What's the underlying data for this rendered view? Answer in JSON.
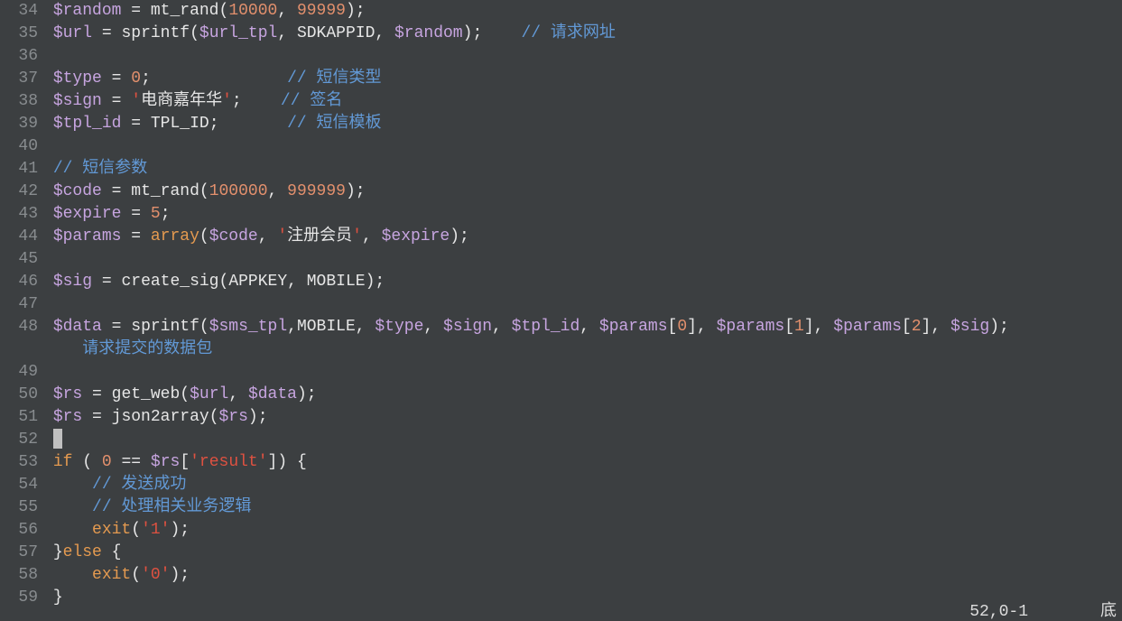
{
  "status": {
    "pos": "52,0-1",
    "mode_hint": "底"
  },
  "lines": [
    {
      "n": "34",
      "wrap": false,
      "tokens": [
        {
          "t": "var",
          "v": "$random"
        },
        {
          "t": "wht",
          "v": " "
        },
        {
          "t": "op",
          "v": "="
        },
        {
          "t": "wht",
          "v": " "
        },
        {
          "t": "func",
          "v": "mt_rand"
        },
        {
          "t": "op",
          "v": "("
        },
        {
          "t": "num",
          "v": "10000"
        },
        {
          "t": "op",
          "v": ","
        },
        {
          "t": "wht",
          "v": " "
        },
        {
          "t": "num",
          "v": "99999"
        },
        {
          "t": "op",
          "v": ")"
        },
        {
          "t": "op",
          "v": ";"
        }
      ]
    },
    {
      "n": "35",
      "wrap": false,
      "tokens": [
        {
          "t": "var",
          "v": "$url"
        },
        {
          "t": "wht",
          "v": " "
        },
        {
          "t": "op",
          "v": "="
        },
        {
          "t": "wht",
          "v": " "
        },
        {
          "t": "func",
          "v": "sprintf"
        },
        {
          "t": "op",
          "v": "("
        },
        {
          "t": "var",
          "v": "$url_tpl"
        },
        {
          "t": "op",
          "v": ","
        },
        {
          "t": "wht",
          "v": " "
        },
        {
          "t": "func",
          "v": "SDKAPPID"
        },
        {
          "t": "op",
          "v": ","
        },
        {
          "t": "wht",
          "v": " "
        },
        {
          "t": "var",
          "v": "$random"
        },
        {
          "t": "op",
          "v": ")"
        },
        {
          "t": "op",
          "v": ";"
        },
        {
          "t": "wht",
          "v": "    "
        },
        {
          "t": "cmt",
          "v": "// 请求网址"
        }
      ]
    },
    {
      "n": "36",
      "wrap": false,
      "tokens": []
    },
    {
      "n": "37",
      "wrap": false,
      "tokens": [
        {
          "t": "var",
          "v": "$type"
        },
        {
          "t": "wht",
          "v": " "
        },
        {
          "t": "op",
          "v": "="
        },
        {
          "t": "wht",
          "v": " "
        },
        {
          "t": "num",
          "v": "0"
        },
        {
          "t": "op",
          "v": ";"
        },
        {
          "t": "wht",
          "v": "              "
        },
        {
          "t": "cmt",
          "v": "// 短信类型"
        }
      ]
    },
    {
      "n": "38",
      "wrap": false,
      "tokens": [
        {
          "t": "var",
          "v": "$sign"
        },
        {
          "t": "wht",
          "v": " "
        },
        {
          "t": "op",
          "v": "="
        },
        {
          "t": "wht",
          "v": " "
        },
        {
          "t": "str",
          "v": "'"
        },
        {
          "t": "strc",
          "v": "电商嘉年华"
        },
        {
          "t": "str",
          "v": "'"
        },
        {
          "t": "op",
          "v": ";"
        },
        {
          "t": "wht",
          "v": "    "
        },
        {
          "t": "cmt",
          "v": "// 签名"
        }
      ]
    },
    {
      "n": "39",
      "wrap": false,
      "tokens": [
        {
          "t": "var",
          "v": "$tpl_id"
        },
        {
          "t": "wht",
          "v": " "
        },
        {
          "t": "op",
          "v": "="
        },
        {
          "t": "wht",
          "v": " "
        },
        {
          "t": "func",
          "v": "TPL_ID"
        },
        {
          "t": "op",
          "v": ";"
        },
        {
          "t": "wht",
          "v": "       "
        },
        {
          "t": "cmt",
          "v": "// 短信模板"
        }
      ]
    },
    {
      "n": "40",
      "wrap": false,
      "tokens": []
    },
    {
      "n": "41",
      "wrap": false,
      "tokens": [
        {
          "t": "cmt",
          "v": "// 短信参数"
        }
      ]
    },
    {
      "n": "42",
      "wrap": false,
      "tokens": [
        {
          "t": "var",
          "v": "$code"
        },
        {
          "t": "wht",
          "v": " "
        },
        {
          "t": "op",
          "v": "="
        },
        {
          "t": "wht",
          "v": " "
        },
        {
          "t": "func",
          "v": "mt_rand"
        },
        {
          "t": "op",
          "v": "("
        },
        {
          "t": "num",
          "v": "100000"
        },
        {
          "t": "op",
          "v": ","
        },
        {
          "t": "wht",
          "v": " "
        },
        {
          "t": "num",
          "v": "999999"
        },
        {
          "t": "op",
          "v": ")"
        },
        {
          "t": "op",
          "v": ";"
        }
      ]
    },
    {
      "n": "43",
      "wrap": false,
      "tokens": [
        {
          "t": "var",
          "v": "$expire"
        },
        {
          "t": "wht",
          "v": " "
        },
        {
          "t": "op",
          "v": "="
        },
        {
          "t": "wht",
          "v": " "
        },
        {
          "t": "num",
          "v": "5"
        },
        {
          "t": "op",
          "v": ";"
        }
      ]
    },
    {
      "n": "44",
      "wrap": false,
      "tokens": [
        {
          "t": "var",
          "v": "$params"
        },
        {
          "t": "wht",
          "v": " "
        },
        {
          "t": "op",
          "v": "="
        },
        {
          "t": "wht",
          "v": " "
        },
        {
          "t": "kw",
          "v": "array"
        },
        {
          "t": "op",
          "v": "("
        },
        {
          "t": "var",
          "v": "$code"
        },
        {
          "t": "op",
          "v": ","
        },
        {
          "t": "wht",
          "v": " "
        },
        {
          "t": "str",
          "v": "'"
        },
        {
          "t": "strc",
          "v": "注册会员"
        },
        {
          "t": "str",
          "v": "'"
        },
        {
          "t": "op",
          "v": ","
        },
        {
          "t": "wht",
          "v": " "
        },
        {
          "t": "var",
          "v": "$expire"
        },
        {
          "t": "op",
          "v": ")"
        },
        {
          "t": "op",
          "v": ";"
        }
      ]
    },
    {
      "n": "45",
      "wrap": false,
      "tokens": []
    },
    {
      "n": "46",
      "wrap": false,
      "tokens": [
        {
          "t": "var",
          "v": "$sig"
        },
        {
          "t": "wht",
          "v": " "
        },
        {
          "t": "op",
          "v": "="
        },
        {
          "t": "wht",
          "v": " "
        },
        {
          "t": "func",
          "v": "create_sig"
        },
        {
          "t": "op",
          "v": "("
        },
        {
          "t": "func",
          "v": "APPKEY"
        },
        {
          "t": "op",
          "v": ","
        },
        {
          "t": "wht",
          "v": " "
        },
        {
          "t": "func",
          "v": "MOBILE"
        },
        {
          "t": "op",
          "v": ")"
        },
        {
          "t": "op",
          "v": ";"
        }
      ]
    },
    {
      "n": "47",
      "wrap": false,
      "tokens": []
    },
    {
      "n": "48",
      "wrap": false,
      "tokens": [
        {
          "t": "var",
          "v": "$data"
        },
        {
          "t": "wht",
          "v": " "
        },
        {
          "t": "op",
          "v": "="
        },
        {
          "t": "wht",
          "v": " "
        },
        {
          "t": "func",
          "v": "sprintf"
        },
        {
          "t": "op",
          "v": "("
        },
        {
          "t": "var",
          "v": "$sms_tpl"
        },
        {
          "t": "op",
          "v": ","
        },
        {
          "t": "func",
          "v": "MOBILE"
        },
        {
          "t": "op",
          "v": ","
        },
        {
          "t": "wht",
          "v": " "
        },
        {
          "t": "var",
          "v": "$type"
        },
        {
          "t": "op",
          "v": ","
        },
        {
          "t": "wht",
          "v": " "
        },
        {
          "t": "var",
          "v": "$sign"
        },
        {
          "t": "op",
          "v": ","
        },
        {
          "t": "wht",
          "v": " "
        },
        {
          "t": "var",
          "v": "$tpl_id"
        },
        {
          "t": "op",
          "v": ","
        },
        {
          "t": "wht",
          "v": " "
        },
        {
          "t": "var",
          "v": "$params"
        },
        {
          "t": "op",
          "v": "["
        },
        {
          "t": "num",
          "v": "0"
        },
        {
          "t": "op",
          "v": "]"
        },
        {
          "t": "op",
          "v": ","
        },
        {
          "t": "wht",
          "v": " "
        },
        {
          "t": "var",
          "v": "$params"
        },
        {
          "t": "op",
          "v": "["
        },
        {
          "t": "num",
          "v": "1"
        },
        {
          "t": "op",
          "v": "]"
        },
        {
          "t": "op",
          "v": ","
        },
        {
          "t": "wht",
          "v": " "
        },
        {
          "t": "var",
          "v": "$params"
        },
        {
          "t": "op",
          "v": "["
        },
        {
          "t": "num",
          "v": "2"
        },
        {
          "t": "op",
          "v": "]"
        },
        {
          "t": "op",
          "v": ","
        },
        {
          "t": "wht",
          "v": " "
        },
        {
          "t": "var",
          "v": "$sig"
        },
        {
          "t": "op",
          "v": ")"
        },
        {
          "t": "op",
          "v": ";"
        }
      ]
    },
    {
      "n": "",
      "wrap": true,
      "tokens": [
        {
          "t": "cmt",
          "v": "请求提交的数据包"
        }
      ]
    },
    {
      "n": "49",
      "wrap": false,
      "tokens": []
    },
    {
      "n": "50",
      "wrap": false,
      "tokens": [
        {
          "t": "var",
          "v": "$rs"
        },
        {
          "t": "wht",
          "v": " "
        },
        {
          "t": "op",
          "v": "="
        },
        {
          "t": "wht",
          "v": " "
        },
        {
          "t": "func",
          "v": "get_web"
        },
        {
          "t": "op",
          "v": "("
        },
        {
          "t": "var",
          "v": "$url"
        },
        {
          "t": "op",
          "v": ","
        },
        {
          "t": "wht",
          "v": " "
        },
        {
          "t": "var",
          "v": "$data"
        },
        {
          "t": "op",
          "v": ")"
        },
        {
          "t": "op",
          "v": ";"
        }
      ]
    },
    {
      "n": "51",
      "wrap": false,
      "tokens": [
        {
          "t": "var",
          "v": "$rs"
        },
        {
          "t": "wht",
          "v": " "
        },
        {
          "t": "op",
          "v": "="
        },
        {
          "t": "wht",
          "v": " "
        },
        {
          "t": "func",
          "v": "json2array"
        },
        {
          "t": "op",
          "v": "("
        },
        {
          "t": "var",
          "v": "$rs"
        },
        {
          "t": "op",
          "v": ")"
        },
        {
          "t": "op",
          "v": ";"
        }
      ]
    },
    {
      "n": "52",
      "wrap": false,
      "cursor": true,
      "tokens": []
    },
    {
      "n": "53",
      "wrap": false,
      "tokens": [
        {
          "t": "kw",
          "v": "if"
        },
        {
          "t": "wht",
          "v": " "
        },
        {
          "t": "op",
          "v": "("
        },
        {
          "t": "wht",
          "v": " "
        },
        {
          "t": "num",
          "v": "0"
        },
        {
          "t": "wht",
          "v": " "
        },
        {
          "t": "op",
          "v": "=="
        },
        {
          "t": "wht",
          "v": " "
        },
        {
          "t": "var",
          "v": "$rs"
        },
        {
          "t": "op",
          "v": "["
        },
        {
          "t": "str",
          "v": "'result'"
        },
        {
          "t": "op",
          "v": "]"
        },
        {
          "t": "op",
          "v": ")"
        },
        {
          "t": "wht",
          "v": " "
        },
        {
          "t": "op",
          "v": "{"
        }
      ]
    },
    {
      "n": "54",
      "wrap": false,
      "tokens": [
        {
          "t": "wht",
          "v": "    "
        },
        {
          "t": "cmt",
          "v": "// 发送成功"
        }
      ]
    },
    {
      "n": "55",
      "wrap": false,
      "tokens": [
        {
          "t": "wht",
          "v": "    "
        },
        {
          "t": "cmt",
          "v": "// 处理相关业务逻辑"
        }
      ]
    },
    {
      "n": "56",
      "wrap": false,
      "tokens": [
        {
          "t": "wht",
          "v": "    "
        },
        {
          "t": "kw",
          "v": "exit"
        },
        {
          "t": "op",
          "v": "("
        },
        {
          "t": "str",
          "v": "'1'"
        },
        {
          "t": "op",
          "v": ")"
        },
        {
          "t": "op",
          "v": ";"
        }
      ]
    },
    {
      "n": "57",
      "wrap": false,
      "tokens": [
        {
          "t": "op",
          "v": "}"
        },
        {
          "t": "kw",
          "v": "else"
        },
        {
          "t": "wht",
          "v": " "
        },
        {
          "t": "op",
          "v": "{"
        }
      ]
    },
    {
      "n": "58",
      "wrap": false,
      "tokens": [
        {
          "t": "wht",
          "v": "    "
        },
        {
          "t": "kw",
          "v": "exit"
        },
        {
          "t": "op",
          "v": "("
        },
        {
          "t": "str",
          "v": "'0'"
        },
        {
          "t": "op",
          "v": ")"
        },
        {
          "t": "op",
          "v": ";"
        }
      ]
    },
    {
      "n": "59",
      "wrap": false,
      "tokens": [
        {
          "t": "op",
          "v": "}"
        }
      ]
    }
  ]
}
